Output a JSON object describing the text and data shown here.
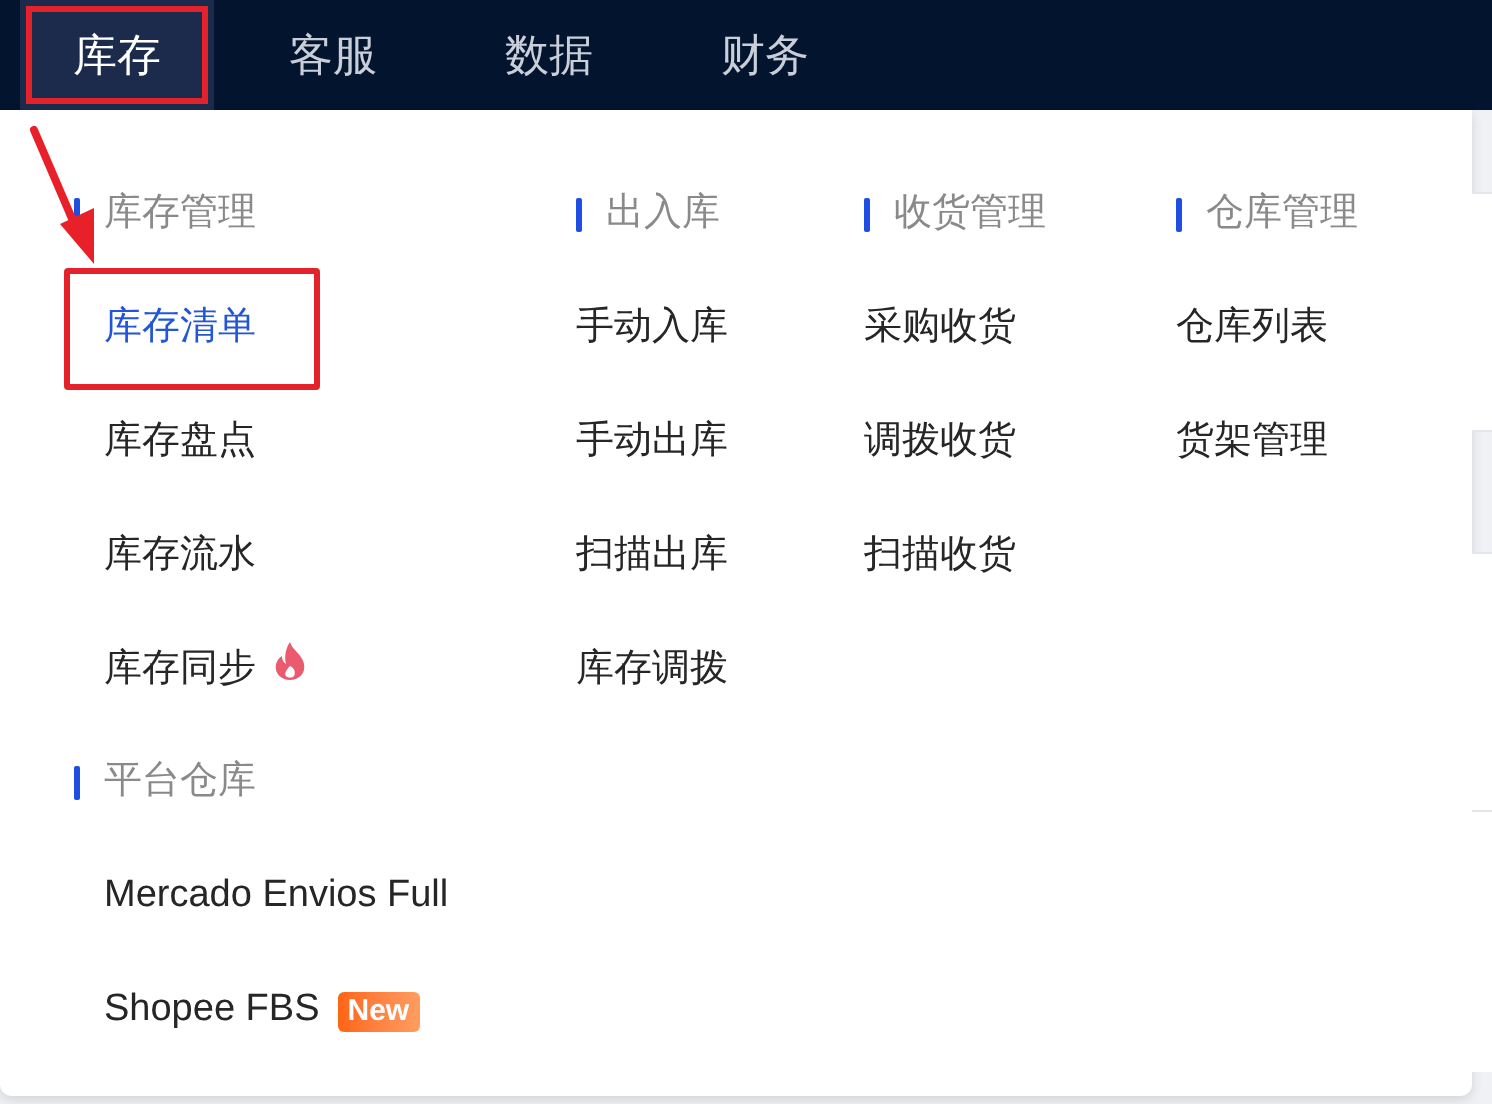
{
  "nav": {
    "tabs": [
      {
        "label": "库存",
        "selected": true,
        "highlighted": true
      },
      {
        "label": "客服",
        "selected": false,
        "highlighted": false
      },
      {
        "label": "数据",
        "selected": false,
        "highlighted": false
      },
      {
        "label": "财务",
        "selected": false,
        "highlighted": false
      }
    ]
  },
  "menu": {
    "columns": [
      {
        "groups": [
          {
            "heading": "库存管理",
            "items": [
              {
                "label": "库存清单",
                "selected": true,
                "highlighted": true
              },
              {
                "label": "库存盘点",
                "selected": false,
                "highlighted": false
              },
              {
                "label": "库存流水",
                "selected": false,
                "highlighted": false
              },
              {
                "label": "库存同步",
                "selected": false,
                "highlighted": false,
                "badge": {
                  "kind": "hot"
                }
              }
            ]
          },
          {
            "heading": "平台仓库",
            "items": [
              {
                "label": "Mercado Envios Full",
                "selected": false,
                "highlighted": false
              },
              {
                "label": "Shopee FBS",
                "selected": false,
                "highlighted": false,
                "badge": {
                  "kind": "new",
                  "text": "New"
                }
              }
            ]
          }
        ]
      },
      {
        "groups": [
          {
            "heading": "出入库",
            "items": [
              {
                "label": "手动入库",
                "selected": false,
                "highlighted": false
              },
              {
                "label": "手动出库",
                "selected": false,
                "highlighted": false
              },
              {
                "label": "扫描出库",
                "selected": false,
                "highlighted": false
              },
              {
                "label": "库存调拨",
                "selected": false,
                "highlighted": false
              }
            ]
          }
        ]
      },
      {
        "groups": [
          {
            "heading": "收货管理",
            "items": [
              {
                "label": "采购收货",
                "selected": false,
                "highlighted": false
              },
              {
                "label": "调拨收货",
                "selected": false,
                "highlighted": false
              },
              {
                "label": "扫描收货",
                "selected": false,
                "highlighted": false
              }
            ]
          }
        ]
      },
      {
        "groups": [
          {
            "heading": "仓库管理",
            "items": [
              {
                "label": "仓库列表",
                "selected": false,
                "highlighted": false
              },
              {
                "label": "货架管理",
                "selected": false,
                "highlighted": false
              }
            ]
          }
        ]
      }
    ]
  }
}
